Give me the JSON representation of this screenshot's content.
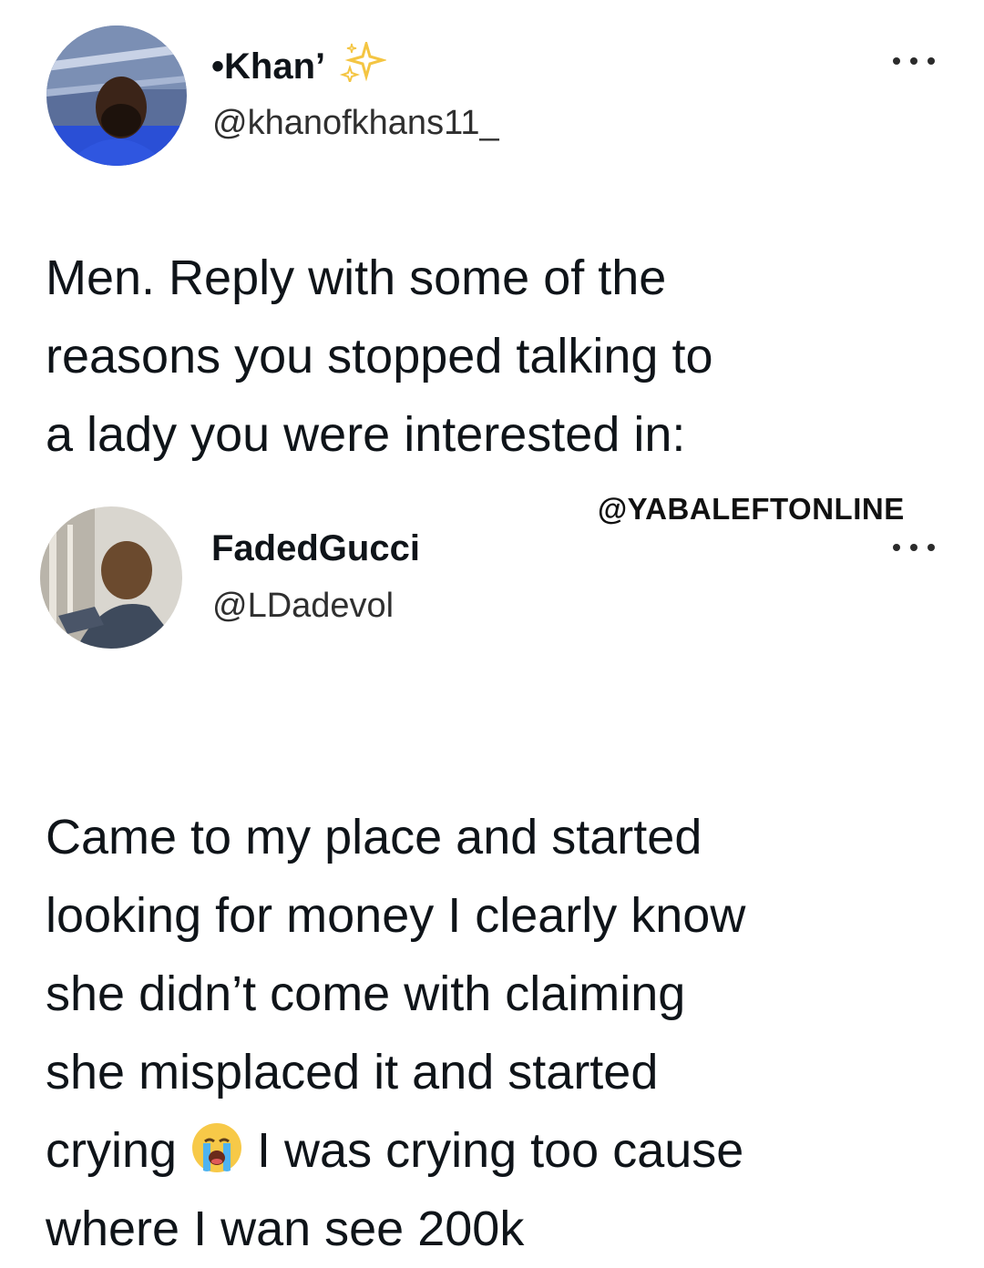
{
  "tweet1": {
    "display_name": "•Khan’",
    "name_suffix_icon": "sparkles-icon",
    "handle": "@khanofkhans11_",
    "more_icon": "more-dots-icon",
    "text": "Men. Reply with some of the\nreasons you stopped talking to\na lady you were interested in:"
  },
  "watermark": "@YABALEFTONLINE",
  "tweet2": {
    "display_name": "FadedGucci",
    "handle": "@LDadevol",
    "more_icon": "more-dots-icon",
    "text_part1": "Came to my place and started\nlooking for money I clearly know\nshe didn’t come with claiming\nshe misplaced it and started\ncrying ",
    "emoji": "loudly-crying-face-icon",
    "text_part2": " I was crying too cause\nwhere I wan see 200k"
  },
  "colors": {
    "text": "#0f1419",
    "handle": "#2f2f2f",
    "sparkle": "#f4c542",
    "avatar1_bg": "#2a4fd6"
  }
}
